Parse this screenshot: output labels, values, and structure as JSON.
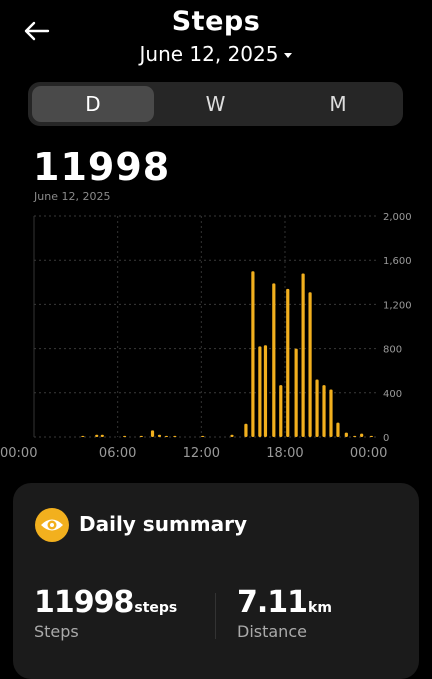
{
  "header": {
    "title": "Steps",
    "date": "June 12, 2025"
  },
  "tabs": [
    {
      "label": "D",
      "active": true
    },
    {
      "label": "W",
      "active": false
    },
    {
      "label": "M",
      "active": false
    }
  ],
  "summary_top": {
    "count": "11998",
    "date": "June 12, 2025"
  },
  "colors": {
    "accent": "#f2b01e",
    "card_bg": "#1b1b1b",
    "segment_bg": "#262626"
  },
  "chart_data": {
    "type": "bar",
    "ylim": [
      0,
      2000
    ],
    "y_ticks": [
      "2,000",
      "1,600",
      "1,200",
      "800",
      "400",
      "0"
    ],
    "y_tick_values": [
      2000,
      1600,
      1200,
      800,
      400,
      0
    ],
    "x_ticks": [
      "00:00",
      "06:00",
      "12:00",
      "18:00",
      "00:00"
    ],
    "x_tick_hours": [
      0,
      6,
      12,
      18,
      24
    ],
    "bar_color": "#f2b01e",
    "x": [
      3.5,
      4.5,
      4.9,
      6.5,
      7.7,
      8.5,
      9,
      9.5,
      10.1,
      12.1,
      14.2,
      15.2,
      15.7,
      16.2,
      16.6,
      17.2,
      17.7,
      18.2,
      18.8,
      19.3,
      19.8,
      20.3,
      20.8,
      21.3,
      21.8,
      22.4,
      23.0,
      23.5,
      24.2
    ],
    "values": [
      10,
      20,
      20,
      10,
      10,
      60,
      20,
      10,
      10,
      10,
      20,
      120,
      1500,
      820,
      830,
      1390,
      470,
      1340,
      800,
      1480,
      1310,
      520,
      470,
      430,
      130,
      40,
      10,
      30,
      10
    ]
  },
  "card": {
    "title": "Daily summary",
    "icon": "eye-icon",
    "steps_value": "11998",
    "steps_unit": "steps",
    "steps_label": "Steps",
    "distance_value": "7.11",
    "distance_unit": "km",
    "distance_label": "Distance"
  }
}
